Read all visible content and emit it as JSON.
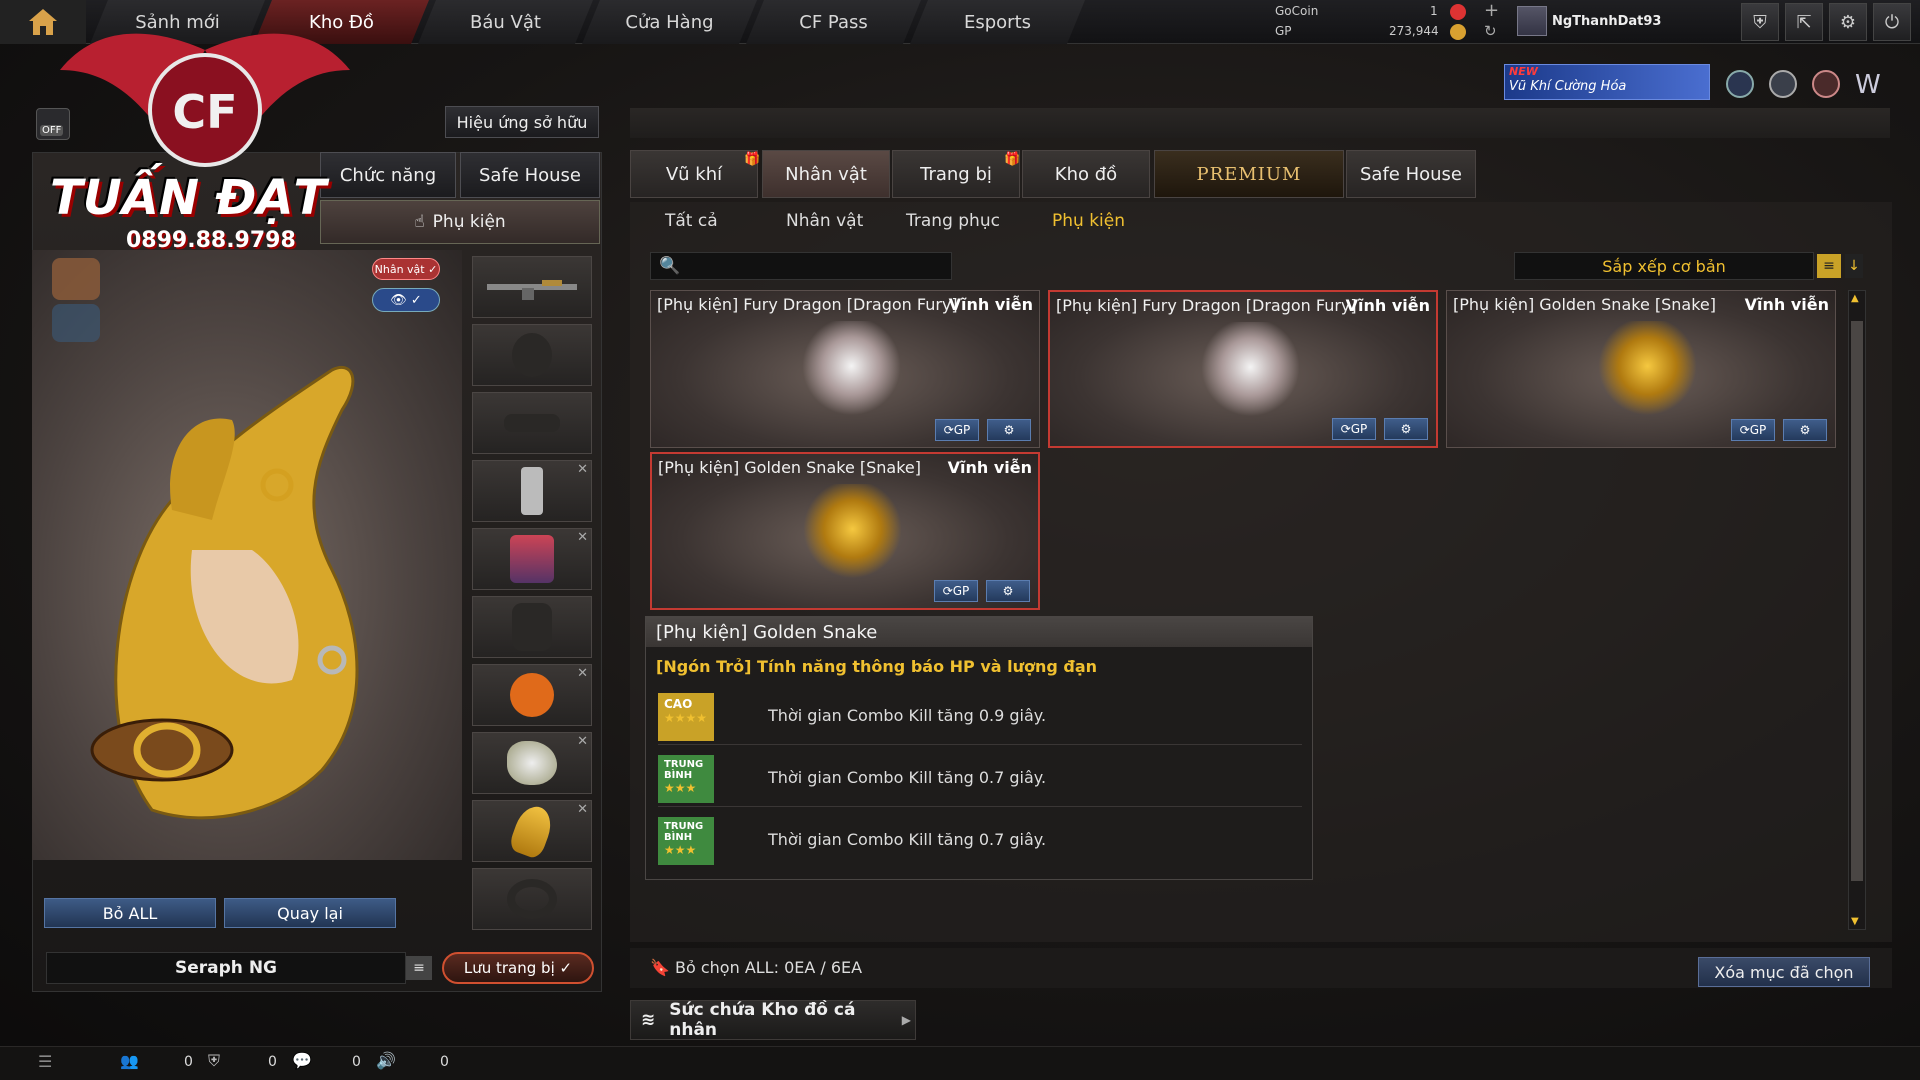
{
  "topnav": {
    "tabs": [
      "Sảnh mới",
      "Kho Đồ",
      "Báu Vật",
      "Cửa Hàng",
      "CF Pass",
      "Esports"
    ],
    "active_tab": 1
  },
  "currency": {
    "gocoin_label": "GoCoin",
    "gocoin_value": "1",
    "gp_label": "GP",
    "gp_value": "273,944"
  },
  "user": {
    "name": "NgThanhDat93"
  },
  "promo": {
    "new_badge": "NEW",
    "text": "Vũ Khí Cường Hóa"
  },
  "logo": {
    "name": "TUẤN ĐẠT",
    "phone": "0899.88.9798"
  },
  "left": {
    "toggle_label": "OFF",
    "effect_button": "Hiệu ứng sở hữu",
    "tabs": [
      "Chức năng",
      "Safe House"
    ],
    "accessory_tab": "Phụ kiện",
    "character_badge": "Nhân vật",
    "btn_remove_all": "Bỏ ALL",
    "btn_back": "Quay lại",
    "preset_name": "Seraph NG",
    "save_button": "Lưu trang bị"
  },
  "categories": {
    "tabs": [
      "Vũ khí",
      "Nhân vật",
      "Trang bị",
      "Kho đồ",
      "PREMIUM",
      "Safe House"
    ],
    "active": 1,
    "subtabs": [
      "Tất cả",
      "Nhân vật",
      "Trang phục",
      "Phụ kiện"
    ],
    "active_sub": 3
  },
  "search": {
    "placeholder": ""
  },
  "sort": {
    "label": "Sắp xếp cơ bản"
  },
  "items": [
    {
      "title": "[Phụ kiện] Fury Dragon [Dragon Fury]",
      "duration": "Vĩnh viễn",
      "selected": false,
      "gp_label": "GP"
    },
    {
      "title": "[Phụ kiện] Fury Dragon [Dragon Fury]",
      "duration": "Vĩnh viễn",
      "selected": true,
      "gp_label": "GP"
    },
    {
      "title": "[Phụ kiện] Golden Snake [Snake]",
      "duration": "Vĩnh viễn",
      "selected": false,
      "gp_label": "GP"
    },
    {
      "title": "[Phụ kiện] Golden Snake [Snake]",
      "duration": "Vĩnh viễn",
      "selected": true,
      "gp_label": "GP"
    }
  ],
  "tooltip": {
    "title": "[Phụ kiện] Golden Snake",
    "subtitle": "[Ngón Trỏ] Tính năng thông báo HP và lượng đạn",
    "rows": [
      {
        "grade": "CAO",
        "stars": "★★★★",
        "grade_color": "#c9a227",
        "text": "Thời gian Combo Kill tăng 0.9 giây."
      },
      {
        "grade": "TRUNG BÌNH",
        "stars": "★★★",
        "grade_color": "#3f8a3f",
        "text": "Thời gian Combo Kill tăng 0.7 giây."
      },
      {
        "grade": "TRUNG BÌNH",
        "stars": "★★★",
        "grade_color": "#3f8a3f",
        "text": "Thời gian Combo Kill tăng 0.7 giây."
      }
    ]
  },
  "bottom": {
    "deselect": "Bỏ chọn ALL: 0EA / 6EA",
    "delete_selected": "Xóa mục đã chọn",
    "capacity": "Sức chứa Kho đồ cá nhân"
  },
  "statusbar": {
    "counts": [
      "0",
      "0",
      "0",
      "0"
    ]
  }
}
